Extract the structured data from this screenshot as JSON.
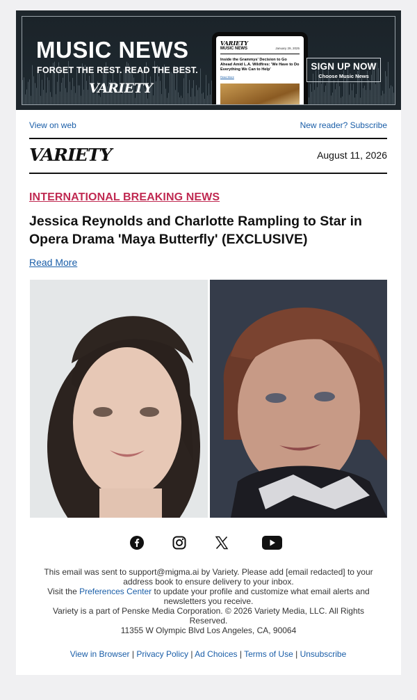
{
  "banner": {
    "title": "MUSIC NEWS",
    "subtitle": "FORGET THE REST. READ THE BEST.",
    "logo": "VARIETY",
    "signup_label": "SIGN UP NOW",
    "signup_sublabel": "Choose Music News",
    "phone_preview": {
      "logo": "VARIETY",
      "section": "MUSIC NEWS",
      "date": "January 29, 2025",
      "headline": "Inside the Grammys' Decision to Go Ahead Amid L.A. Wildfires: 'We Have to Do Everything We Can to Help'",
      "link": "Read More"
    }
  },
  "header": {
    "view_on_web": "View on web",
    "new_reader": "New reader? Subscribe",
    "logo": "VARIETY",
    "date": "August 11, 2026"
  },
  "article": {
    "kicker": "INTERNATIONAL BREAKING NEWS",
    "headline": "Jessica Reynolds and Charlotte Rampling to Star in Opera Drama 'Maya Butterfly' (EXCLUSIVE)",
    "read_more": "Read More"
  },
  "social": [
    "facebook-icon",
    "instagram-icon",
    "x-icon",
    "youtube-icon"
  ],
  "footer": {
    "line1": "This email was sent to support@migma.ai by Variety. Please add [email redacted] to your address book to ensure delivery to your inbox.",
    "line2_prefix": "Visit the ",
    "line2_link": "Preferences Center",
    "line2_suffix": " to update your profile and customize what email alerts and newsletters you receive.",
    "line3": "Variety is a part of Penske Media Corporation. © 2026 Variety Media, LLC. All Rights Reserved.",
    "line4": "11355 W Olympic Blvd Los Angeles, CA, 90064",
    "links": [
      "View in Browser",
      "Privacy Policy",
      "Ad Choices",
      "Terms of Use",
      "Unsubscribe"
    ]
  },
  "colors": {
    "accent": "#c02a52",
    "link": "#1a5ea8",
    "banner_bg": "#1e262c",
    "page_bg": "#f0f0f2"
  }
}
